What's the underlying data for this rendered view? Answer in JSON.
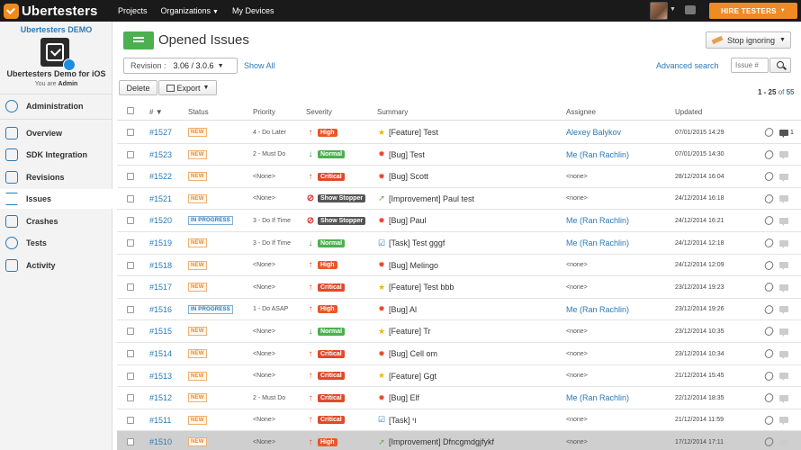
{
  "brand": {
    "name": "Ubertesters",
    "accent": "#f08a24",
    "link": "#2a7ab8"
  },
  "topnav": {
    "projects": "Projects",
    "organizations": "Organizations",
    "devices": "My Devices",
    "hire_button": "HIRE TESTERS"
  },
  "sidebar": {
    "project_name": "Ubertesters DEMO",
    "app_name": "Ubertesters Demo for iOS",
    "user_prefix": "You are",
    "user_role": "Admin",
    "admin_label": "Administration",
    "items": [
      {
        "label": "Overview",
        "icon": "overview-icon"
      },
      {
        "label": "SDK Integration",
        "icon": "sdk-icon"
      },
      {
        "label": "Revisions",
        "icon": "revisions-icon"
      },
      {
        "label": "Issues",
        "icon": "issues-icon"
      },
      {
        "label": "Crashes",
        "icon": "crashes-icon"
      },
      {
        "label": "Tests",
        "icon": "tests-icon"
      },
      {
        "label": "Activity",
        "icon": "activity-icon"
      }
    ]
  },
  "header": {
    "title": "Opened Issues",
    "stop_ignoring": "Stop ignoring"
  },
  "filters": {
    "revision_label": "Revision :",
    "revision_value": "3.06 / 3.0.6",
    "show_all": "Show All",
    "advanced_search": "Advanced search",
    "issue_placeholder": "Issue #"
  },
  "toolbar": {
    "delete": "Delete",
    "export": "Export"
  },
  "pagination": {
    "range": "1 - 25",
    "of": "of",
    "total": "55"
  },
  "columns": {
    "num": "#",
    "status": "Status",
    "priority": "Priority",
    "severity": "Severity",
    "summary": "Summary",
    "assignee": "Assignee",
    "updated": "Updated"
  },
  "severity_colors": {
    "High": "#e8572a",
    "Normal": "#4caf50",
    "Critical": "#e04a2a",
    "Show Stopper": "#555555"
  },
  "rows": [
    {
      "num": "#1527",
      "status": "NEW",
      "priority": "4 - Do Later",
      "sev": "High",
      "type": "Feature",
      "summary": "[Feature] Test",
      "assignee": "Alexey Balykov",
      "updated": "07/01/2015 14:29",
      "comments": "1"
    },
    {
      "num": "#1523",
      "status": "NEW",
      "priority": "2 - Must Do",
      "sev": "Normal",
      "type": "Bug",
      "summary": "[Bug] Test",
      "assignee": "Me (Ran Rachlin)",
      "updated": "07/01/2015 14:30",
      "comments": ""
    },
    {
      "num": "#1522",
      "status": "NEW",
      "priority": "<None>",
      "sev": "Critical",
      "type": "Bug",
      "summary": "[Bug] Scott",
      "assignee": "<none>",
      "updated": "28/12/2014 16:04",
      "comments": ""
    },
    {
      "num": "#1521",
      "status": "NEW",
      "priority": "<None>",
      "sev": "Show Stopper",
      "type": "Improvement",
      "summary": "[Improvement] Paul test",
      "assignee": "<none>",
      "updated": "24/12/2014 16:18",
      "comments": ""
    },
    {
      "num": "#1520",
      "status": "IN PROGRESS",
      "priority": "3 - Do If Time",
      "sev": "Show Stopper",
      "type": "Bug",
      "summary": "[Bug] Paul",
      "assignee": "Me (Ran Rachlin)",
      "updated": "24/12/2014 16:21",
      "comments": ""
    },
    {
      "num": "#1519",
      "status": "NEW",
      "priority": "3 - Do If Time",
      "sev": "Normal",
      "type": "Task",
      "summary": "[Task] Test gggf",
      "assignee": "Me (Ran Rachlin)",
      "updated": "24/12/2014 12:18",
      "comments": ""
    },
    {
      "num": "#1518",
      "status": "NEW",
      "priority": "<None>",
      "sev": "High",
      "type": "Bug",
      "summary": "[Bug] Melingo",
      "assignee": "<none>",
      "updated": "24/12/2014 12:09",
      "comments": ""
    },
    {
      "num": "#1517",
      "status": "NEW",
      "priority": "<None>",
      "sev": "Critical",
      "type": "Feature",
      "summary": "[Feature] Test bbb",
      "assignee": "<none>",
      "updated": "23/12/2014 19:23",
      "comments": ""
    },
    {
      "num": "#1516",
      "status": "IN PROGRESS",
      "priority": "1 - Do ASAP",
      "sev": "High",
      "type": "Bug",
      "summary": "[Bug] Al",
      "assignee": "Me (Ran Rachlin)",
      "updated": "23/12/2014 19:26",
      "comments": ""
    },
    {
      "num": "#1515",
      "status": "NEW",
      "priority": "<None>",
      "sev": "Normal",
      "type": "Feature",
      "summary": "[Feature] Tr",
      "assignee": "<none>",
      "updated": "23/12/2014 10:35",
      "comments": ""
    },
    {
      "num": "#1514",
      "status": "NEW",
      "priority": "<None>",
      "sev": "Critical",
      "type": "Bug",
      "summary": "[Bug] Cell om",
      "assignee": "<none>",
      "updated": "23/12/2014 10:34",
      "comments": ""
    },
    {
      "num": "#1513",
      "status": "NEW",
      "priority": "<None>",
      "sev": "Critical",
      "type": "Feature",
      "summary": "[Feature] Ggt",
      "assignee": "<none>",
      "updated": "21/12/2014 15:45",
      "comments": ""
    },
    {
      "num": "#1512",
      "status": "NEW",
      "priority": "2 - Must Do",
      "sev": "Critical",
      "type": "Bug",
      "summary": "[Bug] Elf",
      "assignee": "Me (Ran Rachlin)",
      "updated": "22/12/2014 18:35",
      "comments": ""
    },
    {
      "num": "#1511",
      "status": "NEW",
      "priority": "<None>",
      "sev": "Critical",
      "type": "Task",
      "summary": "[Task] ױ",
      "assignee": "<none>",
      "updated": "21/12/2014 11:59",
      "comments": ""
    },
    {
      "num": "#1510",
      "status": "NEW",
      "priority": "<None>",
      "sev": "High",
      "type": "Improvement",
      "summary": "[Improvement] Dfncgmdgjfykf",
      "assignee": "<none>",
      "updated": "17/12/2014 17:11",
      "comments": ""
    }
  ]
}
